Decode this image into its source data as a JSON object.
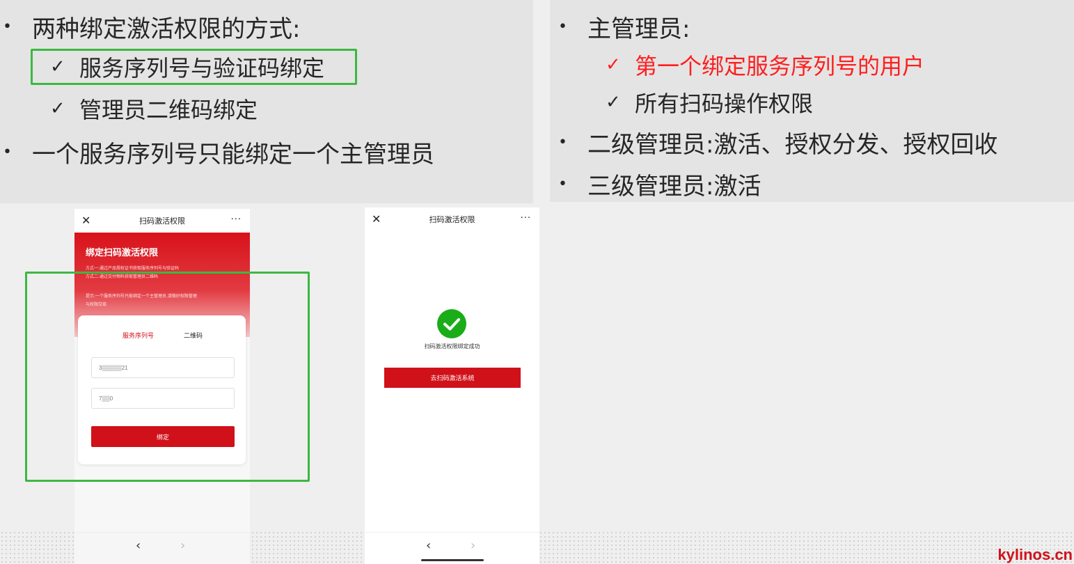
{
  "left_panel": {
    "bullet1": "两种绑定激活权限的方式:",
    "sub1": "服务序列号与验证码绑定",
    "sub2": "管理员二维码绑定",
    "bullet2": "一个服务序列号只能绑定一个主管理员",
    "bullet_glyph": "•",
    "check_glyph": "✓"
  },
  "right_panel": {
    "bullet1": "主管理员:",
    "sub1": "第一个绑定服务序列号的用户",
    "sub2": "所有扫码操作权限",
    "bullet2": "二级管理员:激活、授权分发、授权回收",
    "bullet3": "三级管理员:激活"
  },
  "phone1": {
    "title": "扫码激活权限",
    "close_glyph": "✕",
    "more_glyph": "···",
    "hero_title": "绑定扫码激活权限",
    "hero_line1": "方式一:通过产品授权证书获取服务序列号与验证码",
    "hero_line2": "方式二:通过交付物料获取管理员二维码",
    "hero_tip1": "提示:一个服务序列号只能绑定一个主管理员,请做好权限管理",
    "hero_tip2": "与权限交接",
    "tab_serial": "服务序列号",
    "tab_qr": "二维码",
    "serial_value": "3▒▒▒▒▒21",
    "code_value": "7▒▒0",
    "bind_label": "绑定",
    "back_glyph": "‹",
    "forward_glyph": "›"
  },
  "phone2": {
    "title": "扫码激活权限",
    "success_text": "扫码激活权限绑定成功",
    "go_label": "去扫码激活系统"
  },
  "brand": "kylinos.cn",
  "colors": {
    "accent_red": "#d0111a",
    "highlight_red": "#ff1e1e",
    "highlight_green": "#3cb842",
    "success_green": "#1aad19"
  }
}
